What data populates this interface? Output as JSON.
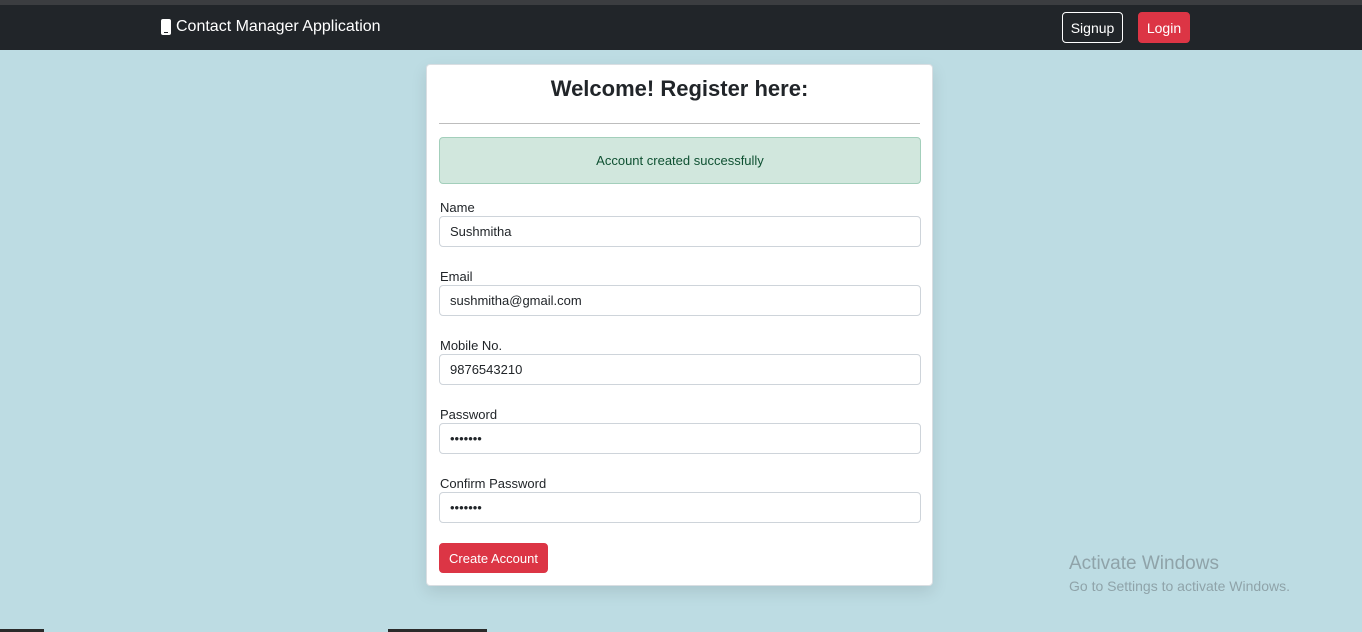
{
  "navbar": {
    "brand": "Contact Manager Application",
    "signup_label": "Signup",
    "login_label": "Login"
  },
  "form": {
    "title": "Welcome! Register here:",
    "alert": "Account created successfully",
    "fields": [
      {
        "label": "Name",
        "value": "Sushmitha"
      },
      {
        "label": "Email",
        "value": "sushmitha@gmail.com"
      },
      {
        "label": "Mobile No.",
        "value": "9876543210"
      },
      {
        "label": "Password",
        "value": "1234567"
      },
      {
        "label": "Confirm Password",
        "value": "1234567"
      }
    ],
    "submit_label": "Create Account"
  },
  "watermark": {
    "title": "Activate Windows",
    "subtitle": "Go to Settings to activate Windows."
  },
  "colors": {
    "background": "#bddce3",
    "navbar": "#212529",
    "danger": "#dc3545",
    "success_bg": "#d1e7dd",
    "success_text": "#0f5132"
  }
}
